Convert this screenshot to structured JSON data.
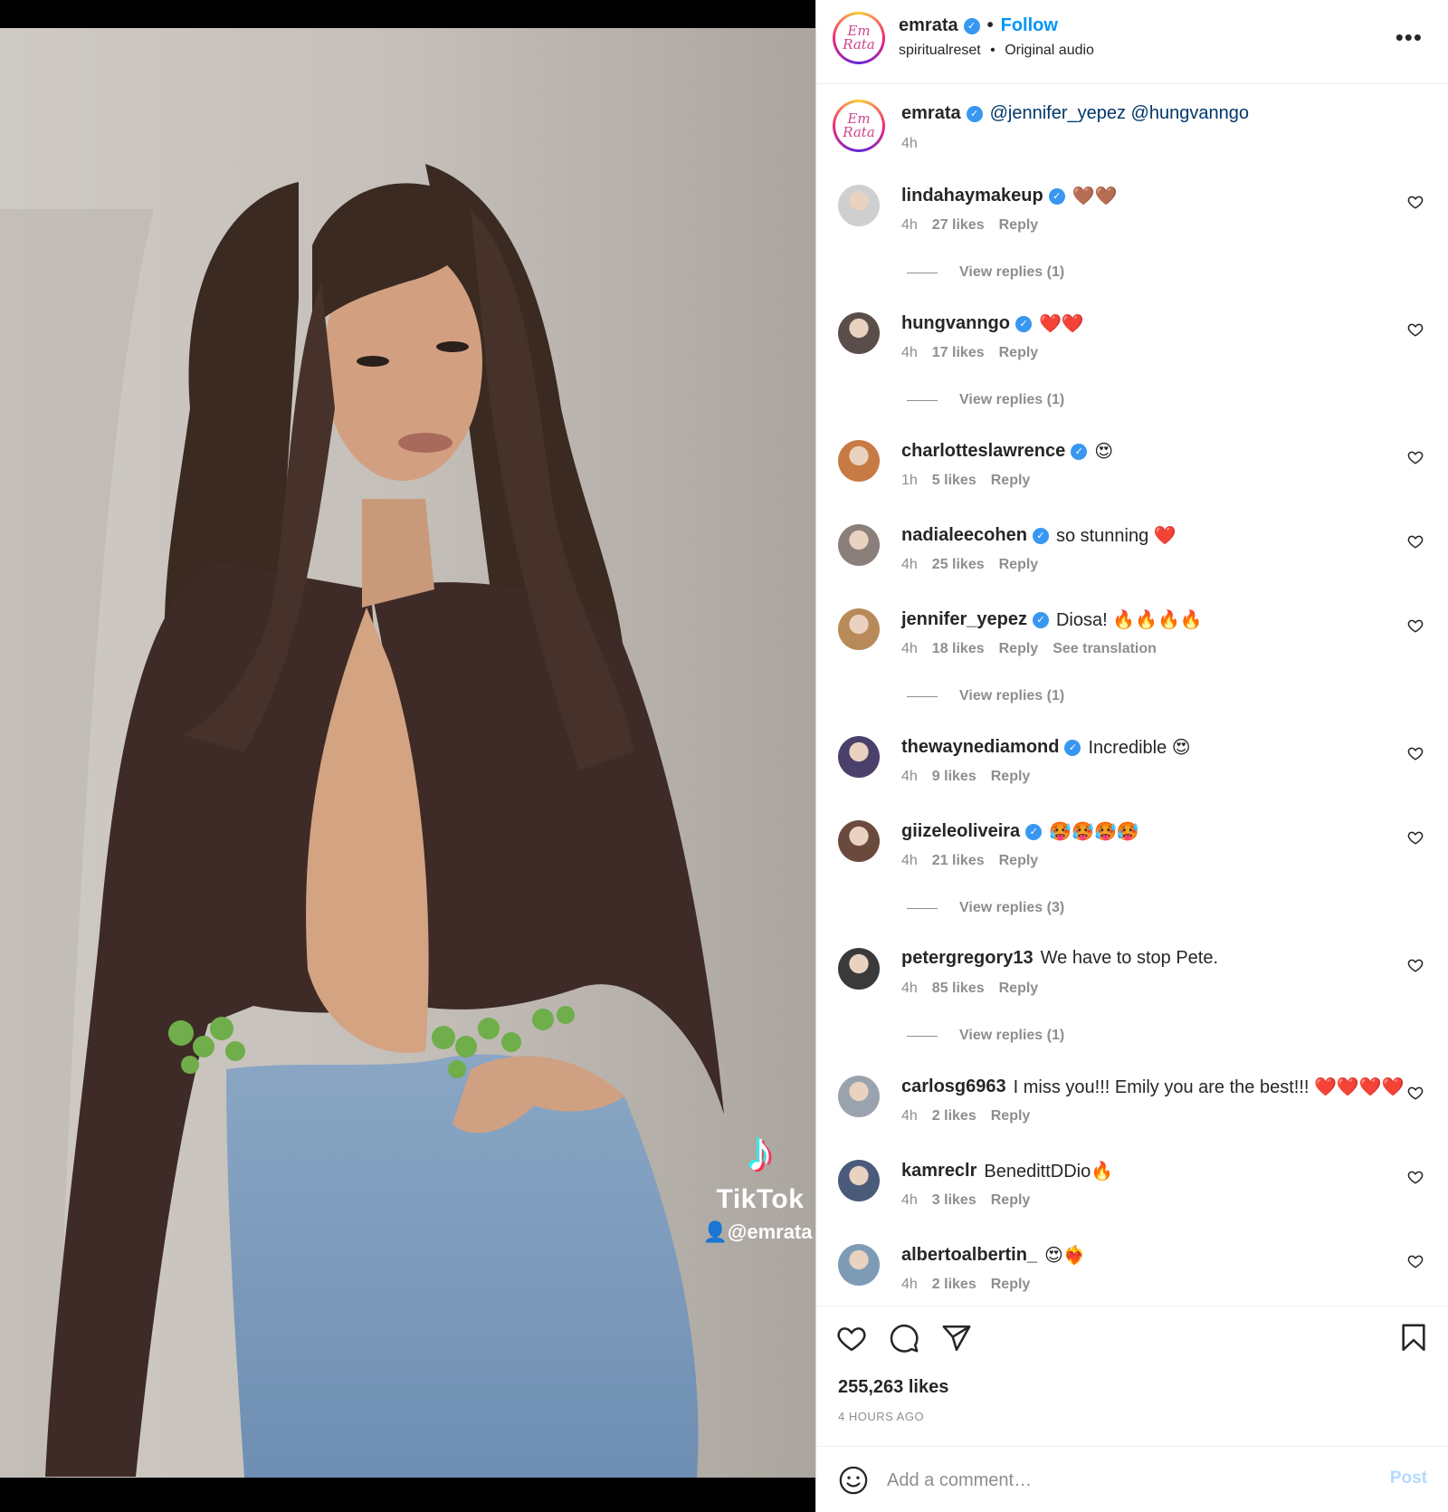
{
  "header": {
    "username": "emrata",
    "follow_label": "Follow",
    "separator": "•",
    "audio_source": "spiritualreset",
    "audio_label": "Original audio",
    "sub_separator": "•",
    "avatar_text": "Em Rata",
    "more_glyph": "•••"
  },
  "media": {
    "watermark": {
      "brand": "TikTok",
      "handle": "@emrata"
    }
  },
  "caption": {
    "username": "emrata",
    "text": "@jennifer_yepez @hungvanngo",
    "time": "4h"
  },
  "comments": [
    {
      "user": "lindahaymakeup",
      "verified": true,
      "text": "🤎🤎",
      "time": "4h",
      "likes": "27 likes",
      "reply": "Reply",
      "view_replies": "View replies (1)"
    },
    {
      "user": "hungvanngo",
      "verified": true,
      "text": "❤️❤️",
      "time": "4h",
      "likes": "17 likes",
      "reply": "Reply",
      "view_replies": "View replies (1)"
    },
    {
      "user": "charlotteslawrence",
      "verified": true,
      "text": "😍",
      "time": "1h",
      "likes": "5 likes",
      "reply": "Reply"
    },
    {
      "user": "nadialeecohen",
      "verified": true,
      "text": "so stunning ❤️",
      "time": "4h",
      "likes": "25 likes",
      "reply": "Reply"
    },
    {
      "user": "jennifer_yepez",
      "verified": true,
      "text": "Diosa! 🔥🔥🔥🔥",
      "time": "4h",
      "likes": "18 likes",
      "reply": "Reply",
      "translation": "See translation",
      "view_replies": "View replies (1)"
    },
    {
      "user": "thewaynediamond",
      "verified": true,
      "text": "Incredible 😍",
      "time": "4h",
      "likes": "9 likes",
      "reply": "Reply"
    },
    {
      "user": "giizeleoliveira",
      "verified": true,
      "text": "🥵🥵🥵🥵",
      "time": "4h",
      "likes": "21 likes",
      "reply": "Reply",
      "view_replies": "View replies (3)"
    },
    {
      "user": "petergregory13",
      "verified": false,
      "text": "We have to stop Pete.",
      "time": "4h",
      "likes": "85 likes",
      "reply": "Reply",
      "view_replies": "View replies (1)"
    },
    {
      "user": "carlosg6963",
      "verified": false,
      "text": "I miss you!!! Emily you are the best!!! ❤️❤️❤️❤️",
      "time": "4h",
      "likes": "2 likes",
      "reply": "Reply"
    },
    {
      "user": "kamreclr",
      "verified": false,
      "text": "BenedittDDio🔥",
      "time": "4h",
      "likes": "3 likes",
      "reply": "Reply"
    },
    {
      "user": "albertoalbertin_",
      "verified": false,
      "text": "😍❤️‍🔥",
      "time": "4h",
      "likes": "2 likes",
      "reply": "Reply"
    }
  ],
  "footer": {
    "likes": "255,263 likes",
    "time_ago": "4 HOURS AGO",
    "comment_placeholder": "Add a comment…",
    "post_label": "Post"
  },
  "colors": {
    "accent": "#0095f6",
    "verified": "#3897f0",
    "muted": "#8e8e8e",
    "post_disabled": "#b3dbff"
  }
}
